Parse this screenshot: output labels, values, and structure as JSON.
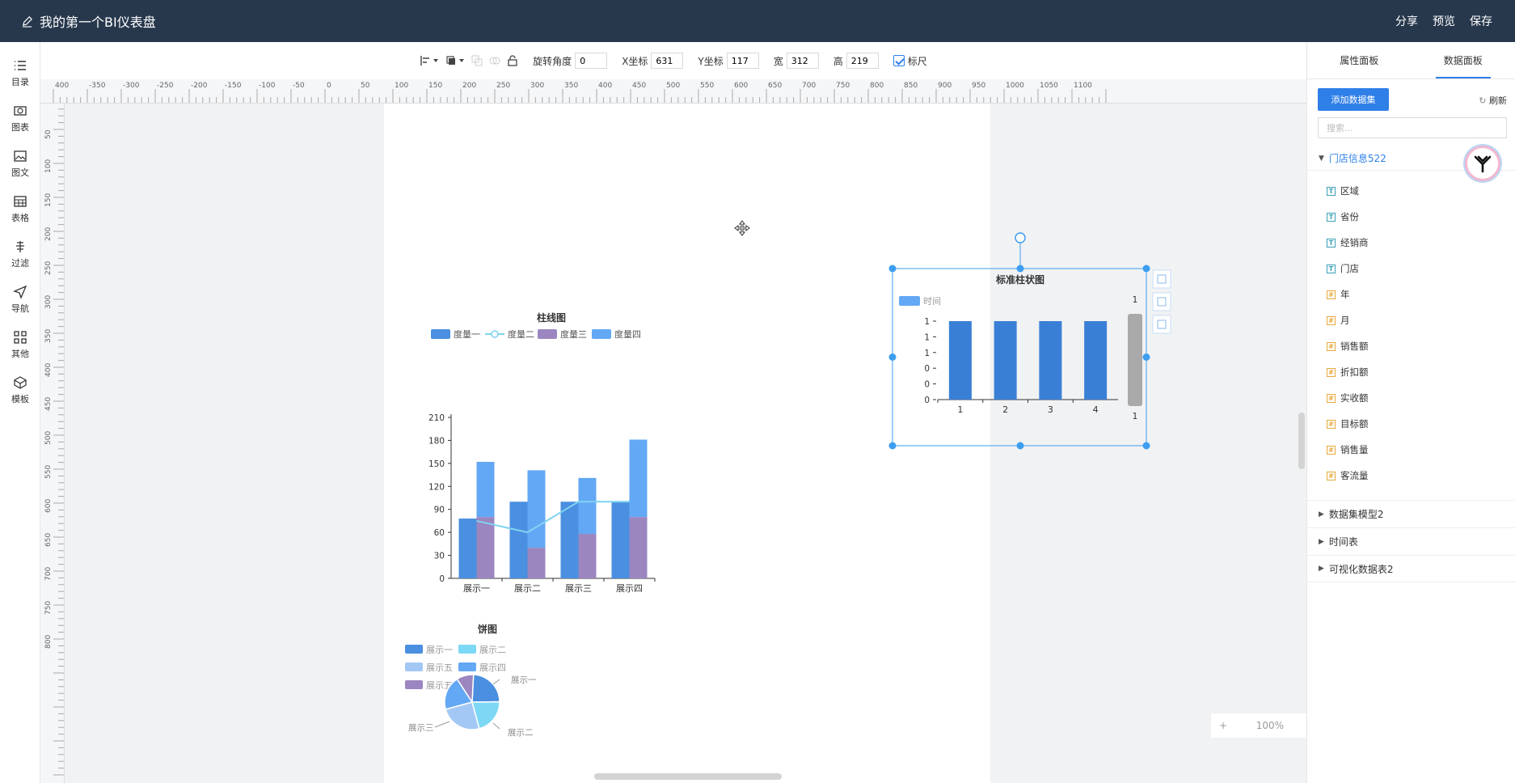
{
  "app": {
    "title": "我的第一个BI仪表盘",
    "actions": [
      "分享",
      "预览",
      "保存"
    ]
  },
  "leftbar": [
    {
      "label": "目录",
      "icon": "list-icon"
    },
    {
      "label": "图表",
      "icon": "chart-icon"
    },
    {
      "label": "图文",
      "icon": "image-icon"
    },
    {
      "label": "表格",
      "icon": "table-icon"
    },
    {
      "label": "过滤",
      "icon": "filter-icon"
    },
    {
      "label": "导航",
      "icon": "navigation-icon"
    },
    {
      "label": "其他",
      "icon": "grid-icon"
    },
    {
      "label": "模板",
      "icon": "template-icon"
    }
  ],
  "toolbar": {
    "rotate_label": "旋转角度",
    "rotate_value": "0",
    "x_label": "X坐标",
    "x_value": "631",
    "y_label": "Y坐标",
    "y_value": "117",
    "w_label": "宽",
    "w_value": "312",
    "h_label": "高",
    "h_value": "219",
    "ruler_label": "标尺",
    "ruler_checked": true
  },
  "ruler_h_ticks": [
    "400",
    "-350",
    "-300",
    "-250",
    "-200",
    "-150",
    "-100",
    "-50",
    "0",
    "50",
    "100",
    "150",
    "200",
    "250",
    "300",
    "350",
    "400",
    "450",
    "500",
    "550",
    "600",
    "650",
    "700",
    "750",
    "800",
    "850",
    "900",
    "950",
    "1000",
    "1050",
    "1100"
  ],
  "ruler_v_ticks": [
    "50",
    "100",
    "150",
    "200",
    "250",
    "300",
    "350",
    "400",
    "450",
    "500",
    "550",
    "600",
    "650",
    "700",
    "750",
    "800"
  ],
  "right_panel": {
    "tabs": [
      "属性面板",
      "数据面板"
    ],
    "active_tab": 1,
    "add_dataset": "添加数据集",
    "refresh": "刷新",
    "search_placeholder": "搜索...",
    "dataset": "门店信息522",
    "fields": [
      {
        "name": "区域",
        "type": "T"
      },
      {
        "name": "省份",
        "type": "T"
      },
      {
        "name": "经销商",
        "type": "T"
      },
      {
        "name": "门店",
        "type": "T"
      },
      {
        "name": "年",
        "type": "#"
      },
      {
        "name": "月",
        "type": "#"
      },
      {
        "name": "销售额",
        "type": "#"
      },
      {
        "name": "折扣额",
        "type": "#"
      },
      {
        "name": "实收额",
        "type": "#"
      },
      {
        "name": "目标额",
        "type": "#"
      },
      {
        "name": "销售量",
        "type": "#"
      },
      {
        "name": "客流量",
        "type": "#"
      }
    ],
    "other_datasets": [
      "数据集模型2",
      "时间表",
      "可视化数据表2"
    ]
  },
  "zoom": {
    "plus": "+",
    "value": "100%",
    "minus": "-"
  },
  "colors": {
    "header": "#27384d",
    "accent": "#2f7fe8",
    "bar": "#3a7fd6",
    "selection": "#3d9ef0"
  },
  "chart_data": [
    {
      "id": "bar_line",
      "type": "bar",
      "title": "柱线图",
      "categories": [
        "展示一",
        "展示二",
        "展示三",
        "展示四"
      ],
      "series": [
        {
          "name": "度量一",
          "type": "bar",
          "stack": "a",
          "color": "#4a8fe0",
          "values": [
            78,
            100,
            100,
            100
          ]
        },
        {
          "name": "度量二",
          "type": "line",
          "color": "#7fd3f0",
          "values": [
            75,
            60,
            100,
            100
          ]
        },
        {
          "name": "度量三",
          "type": "bar",
          "stack": "b",
          "color": "#9b86c0",
          "values": [
            80,
            40,
            58,
            80
          ]
        },
        {
          "name": "度量四",
          "type": "bar",
          "stack": "b",
          "color": "#63a8f5",
          "values": [
            72,
            101,
            73,
            101
          ]
        }
      ],
      "yticks": [
        "0",
        "30",
        "60",
        "90",
        "120",
        "150",
        "180",
        "210"
      ],
      "ylim": [
        0,
        210
      ]
    },
    {
      "id": "standard_bar",
      "type": "bar",
      "title": "标准柱状图",
      "legend": [
        "时间"
      ],
      "categories": [
        "1",
        "2",
        "3",
        "4"
      ],
      "values": [
        1,
        1,
        1,
        1
      ],
      "yticks": [
        "0",
        "0",
        "0",
        "1",
        "1",
        "1"
      ],
      "ylim": [
        0,
        1
      ],
      "slider_top": "1",
      "slider_bottom": "1"
    },
    {
      "id": "pie",
      "type": "pie",
      "title": "饼图",
      "legend": [
        "展示一",
        "展示二",
        "展示五",
        "展示四",
        "展示五"
      ],
      "slices": [
        {
          "name": "展示一",
          "value": 24,
          "color": "#4a8fe0"
        },
        {
          "name": "展示二",
          "value": 21,
          "color": "#7dd8f5"
        },
        {
          "name": "展示三",
          "value": 25,
          "color": "#a4c8f5"
        },
        {
          "name": "展示四",
          "value": 20,
          "color": "#63a8f5"
        },
        {
          "name": "展示五",
          "value": 10,
          "color": "#9b86c0"
        }
      ],
      "outer_labels": [
        "展示一",
        "展示二",
        "展示三"
      ]
    }
  ]
}
